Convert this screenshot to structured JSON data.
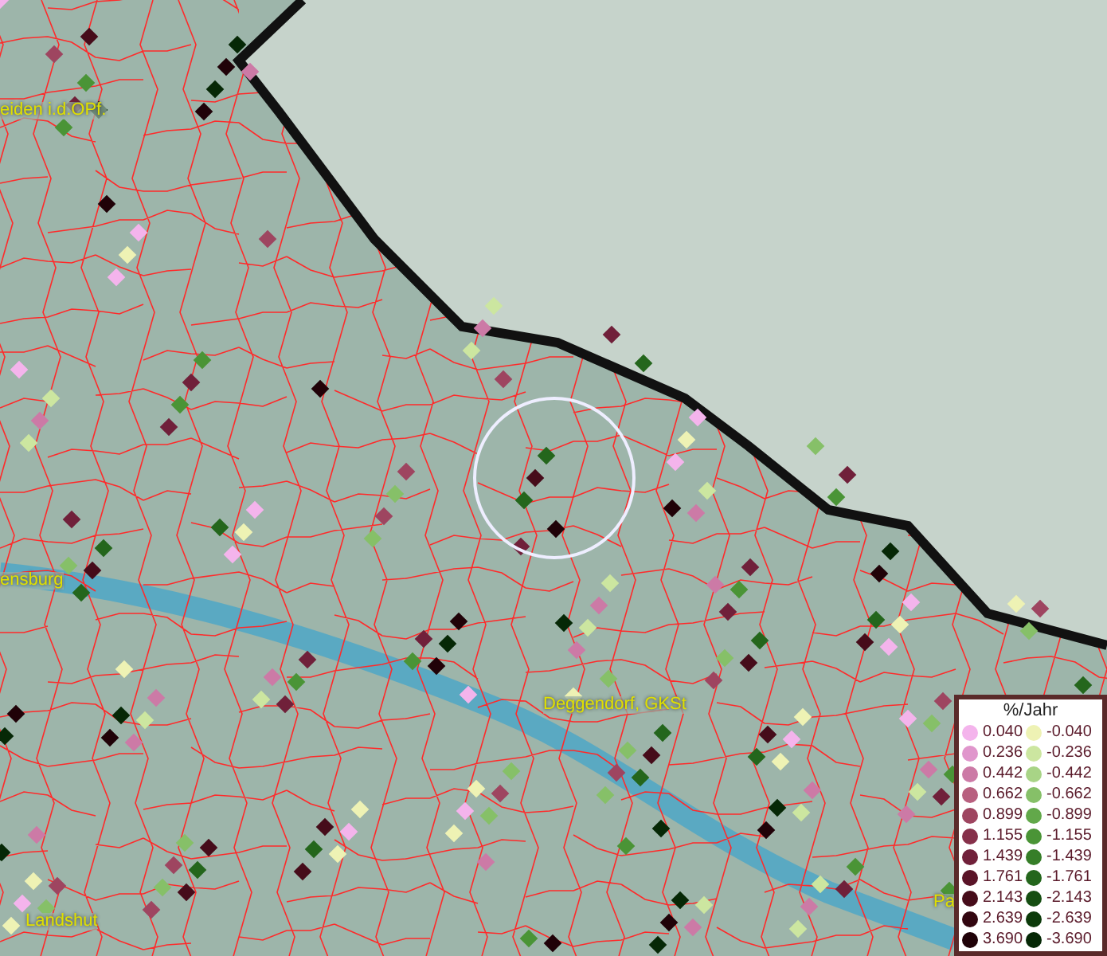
{
  "map": {
    "place_labels": [
      "eiden i.d.OPf.",
      "ensburg",
      "Deggendorf, GKSt",
      "Landshut",
      "Pa"
    ]
  },
  "legend": {
    "title": "%/Jahr",
    "columns": [
      [
        {
          "label": "0.040",
          "color": "#f4b4ec"
        },
        {
          "label": "0.236",
          "color": "#e096cc"
        },
        {
          "label": "0.442",
          "color": "#cc7aa6"
        },
        {
          "label": "0.662",
          "color": "#b8607f"
        },
        {
          "label": "0.899",
          "color": "#9e4560"
        },
        {
          "label": "1.155",
          "color": "#86304a"
        },
        {
          "label": "1.439",
          "color": "#70203a"
        },
        {
          "label": "1.761",
          "color": "#5a1428"
        },
        {
          "label": "2.143",
          "color": "#460c1a"
        },
        {
          "label": "2.639",
          "color": "#320610"
        },
        {
          "label": "3.690",
          "color": "#200208"
        }
      ],
      [
        {
          "label": "-0.040",
          "color": "#eef2b4"
        },
        {
          "label": "-0.236",
          "color": "#cce6a0"
        },
        {
          "label": "-0.442",
          "color": "#a8d486"
        },
        {
          "label": "-0.662",
          "color": "#86c068"
        },
        {
          "label": "-0.899",
          "color": "#62a84a"
        },
        {
          "label": "-1.155",
          "color": "#4a9436"
        },
        {
          "label": "-1.439",
          "color": "#367e28"
        },
        {
          "label": "-1.761",
          "color": "#24661c"
        },
        {
          "label": "-2.143",
          "color": "#164e12"
        },
        {
          "label": "-2.639",
          "color": "#0c3a0a"
        },
        {
          "label": "-3.690",
          "color": "#062806"
        }
      ]
    ]
  }
}
